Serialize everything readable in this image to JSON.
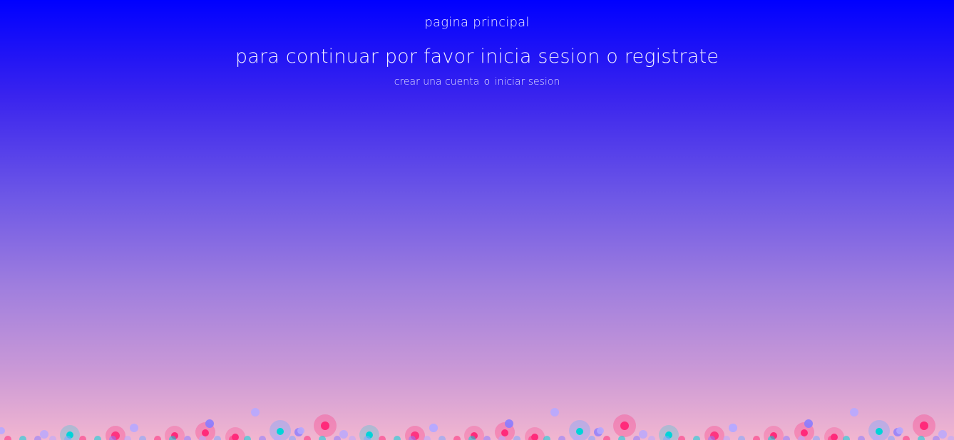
{
  "header": {
    "page_title": "pagina principal",
    "heading": "para continuar por favor inicia sesion o registrate"
  },
  "links": {
    "create_account": "crear una cuenta",
    "separator": "o",
    "login": "iniciar sesion"
  },
  "decoration": {
    "bubble_colors": [
      "#ff2a7a",
      "#00d4d8",
      "#8a7cff",
      "#b7a8ff",
      "#7aa8ff"
    ]
  }
}
